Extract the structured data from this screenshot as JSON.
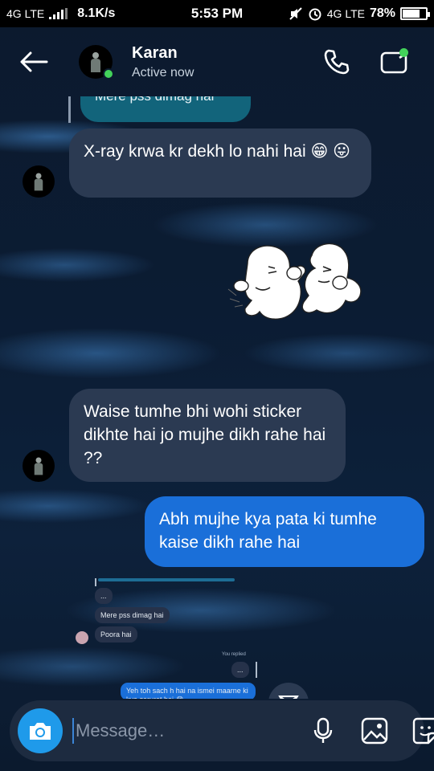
{
  "status_bar": {
    "network_left": "4G LTE",
    "speed": "8.1K/s",
    "time": "5:53 PM",
    "network_right": "4G LTE",
    "battery": "78%",
    "battery_level": 0.78
  },
  "header": {
    "contact_name": "Karan",
    "contact_status": "Active now",
    "icons": [
      "back-arrow-icon",
      "phone-icon",
      "video-call-icon"
    ]
  },
  "messages": {
    "reply_preview": "Mere pss dimag hai",
    "msg1": "X-ray krwa kr dekh lo nahi hai 😁 😛",
    "sticker": "boxing-blobs-sticker",
    "msg2": "Waise tumhe bhi wohi sticker dikhte hai jo mujhe dikh rahe hai ??",
    "msg3": "Abh mujhe kya pata ki tumhe kaise dikh rahe hai"
  },
  "embedded_screenshot": {
    "ellipsis1": "...",
    "line1": "Mere pss dimag hai",
    "line2": "Poora hai",
    "you_replied": "You replied",
    "ellipsis2": "...",
    "mine_text": "Yeh toh sach h hai na ismei maarne ki kya zarurat hai 😂"
  },
  "composer": {
    "placeholder": "Message…",
    "icons": [
      "camera-icon",
      "microphone-icon",
      "gallery-icon",
      "sticker-icon"
    ]
  },
  "colors": {
    "incoming_bubble": "#2b3a52",
    "outgoing_bubble": "#1a6fd9",
    "online": "#43d25a",
    "camera_button": "#1f9aea"
  }
}
